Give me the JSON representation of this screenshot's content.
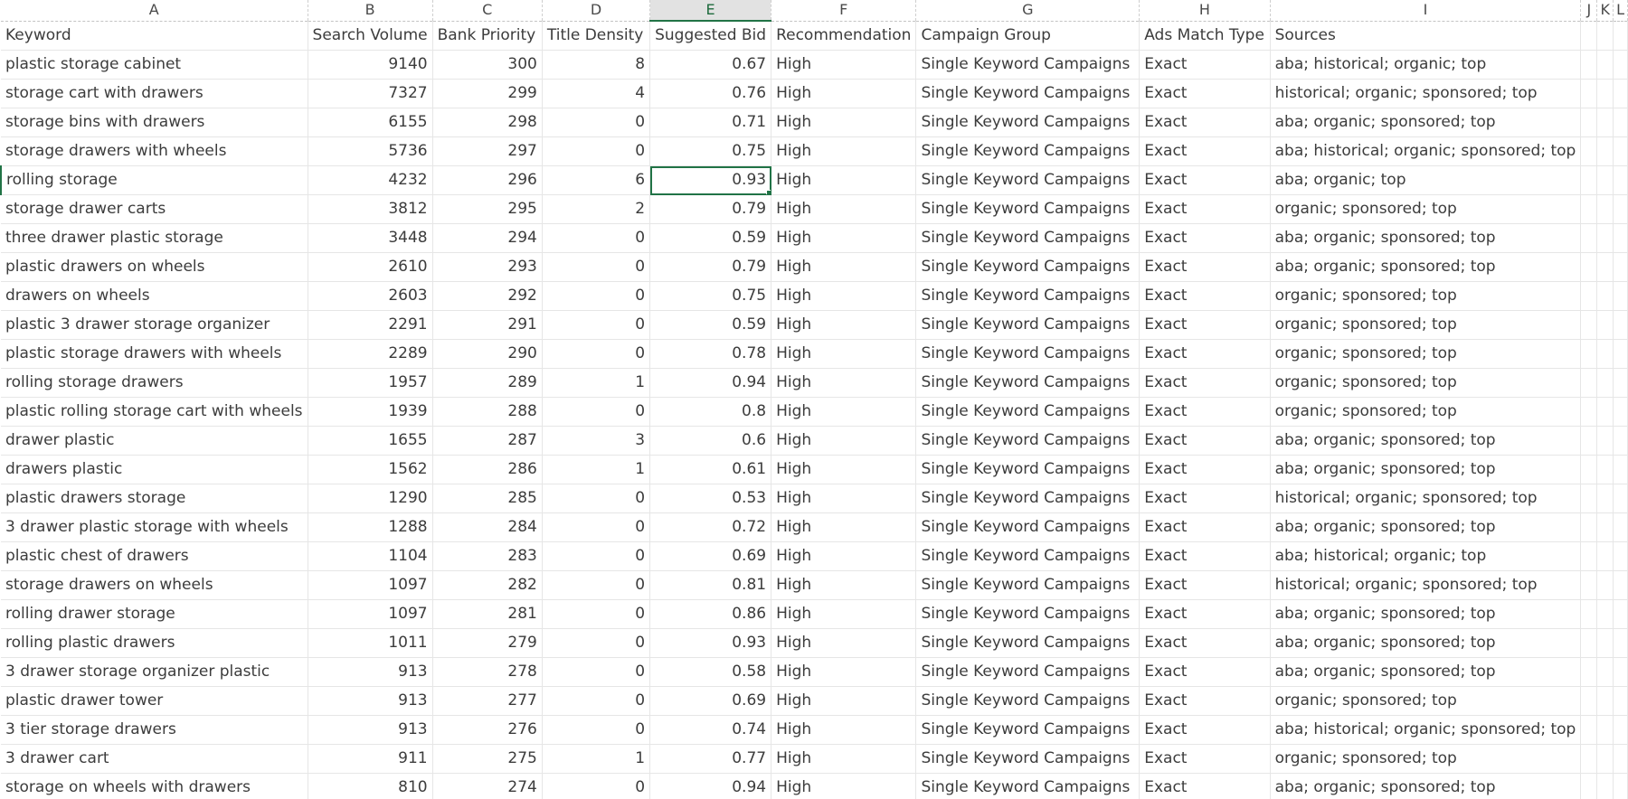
{
  "sheet": {
    "column_letters": [
      "A",
      "B",
      "C",
      "D",
      "E",
      "F",
      "G",
      "H",
      "I",
      "J",
      "K",
      "L"
    ],
    "active_column": "E",
    "headers": [
      "Keyword",
      "Search Volume",
      "Bank Priority",
      "Title Density",
      "Suggested Bid",
      "Recommendation",
      "Campaign Group",
      "Ads Match Type",
      "Sources"
    ],
    "selected_cell": "E5",
    "rows": [
      [
        "plastic storage cabinet",
        "9140",
        "300",
        "8",
        "0.67",
        "High",
        "Single Keyword Campaigns",
        "Exact",
        "aba; historical; organic; top"
      ],
      [
        "storage cart with drawers",
        "7327",
        "299",
        "4",
        "0.76",
        "High",
        "Single Keyword Campaigns",
        "Exact",
        "historical; organic; sponsored; top"
      ],
      [
        "storage bins with drawers",
        "6155",
        "298",
        "0",
        "0.71",
        "High",
        "Single Keyword Campaigns",
        "Exact",
        "aba; organic; sponsored; top"
      ],
      [
        "storage drawers with wheels",
        "5736",
        "297",
        "0",
        "0.75",
        "High",
        "Single Keyword Campaigns",
        "Exact",
        "aba; historical; organic; sponsored; top"
      ],
      [
        "rolling storage",
        "4232",
        "296",
        "6",
        "0.93",
        "High",
        "Single Keyword Campaigns",
        "Exact",
        "aba; organic; top"
      ],
      [
        "storage drawer carts",
        "3812",
        "295",
        "2",
        "0.79",
        "High",
        "Single Keyword Campaigns",
        "Exact",
        "organic; sponsored; top"
      ],
      [
        "three drawer plastic storage",
        "3448",
        "294",
        "0",
        "0.59",
        "High",
        "Single Keyword Campaigns",
        "Exact",
        "aba; organic; sponsored; top"
      ],
      [
        "plastic drawers on wheels",
        "2610",
        "293",
        "0",
        "0.79",
        "High",
        "Single Keyword Campaigns",
        "Exact",
        "aba; organic; sponsored; top"
      ],
      [
        "drawers on wheels",
        "2603",
        "292",
        "0",
        "0.75",
        "High",
        "Single Keyword Campaigns",
        "Exact",
        "organic; sponsored; top"
      ],
      [
        "plastic 3 drawer storage organizer",
        "2291",
        "291",
        "0",
        "0.59",
        "High",
        "Single Keyword Campaigns",
        "Exact",
        "organic; sponsored; top"
      ],
      [
        "plastic storage drawers with wheels",
        "2289",
        "290",
        "0",
        "0.78",
        "High",
        "Single Keyword Campaigns",
        "Exact",
        "organic; sponsored; top"
      ],
      [
        "rolling storage drawers",
        "1957",
        "289",
        "1",
        "0.94",
        "High",
        "Single Keyword Campaigns",
        "Exact",
        "organic; sponsored; top"
      ],
      [
        "plastic rolling storage cart with wheels",
        "1939",
        "288",
        "0",
        "0.8",
        "High",
        "Single Keyword Campaigns",
        "Exact",
        "organic; sponsored; top"
      ],
      [
        "drawer plastic",
        "1655",
        "287",
        "3",
        "0.6",
        "High",
        "Single Keyword Campaigns",
        "Exact",
        "aba; organic; sponsored; top"
      ],
      [
        "drawers plastic",
        "1562",
        "286",
        "1",
        "0.61",
        "High",
        "Single Keyword Campaigns",
        "Exact",
        "aba; organic; sponsored; top"
      ],
      [
        "plastic drawers storage",
        "1290",
        "285",
        "0",
        "0.53",
        "High",
        "Single Keyword Campaigns",
        "Exact",
        "historical; organic; sponsored; top"
      ],
      [
        "3 drawer plastic storage with wheels",
        "1288",
        "284",
        "0",
        "0.72",
        "High",
        "Single Keyword Campaigns",
        "Exact",
        "aba; organic; sponsored; top"
      ],
      [
        "plastic chest of drawers",
        "1104",
        "283",
        "0",
        "0.69",
        "High",
        "Single Keyword Campaigns",
        "Exact",
        "aba; historical; organic; top"
      ],
      [
        "storage drawers on wheels",
        "1097",
        "282",
        "0",
        "0.81",
        "High",
        "Single Keyword Campaigns",
        "Exact",
        "historical; organic; sponsored; top"
      ],
      [
        "rolling drawer storage",
        "1097",
        "281",
        "0",
        "0.86",
        "High",
        "Single Keyword Campaigns",
        "Exact",
        "aba; organic; sponsored; top"
      ],
      [
        "rolling plastic drawers",
        "1011",
        "279",
        "0",
        "0.93",
        "High",
        "Single Keyword Campaigns",
        "Exact",
        "aba; organic; sponsored; top"
      ],
      [
        "3 drawer storage organizer plastic",
        "913",
        "278",
        "0",
        "0.58",
        "High",
        "Single Keyword Campaigns",
        "Exact",
        "aba; organic; sponsored; top"
      ],
      [
        "plastic drawer tower",
        "913",
        "277",
        "0",
        "0.69",
        "High",
        "Single Keyword Campaigns",
        "Exact",
        "organic; sponsored; top"
      ],
      [
        "3 tier storage drawers",
        "913",
        "276",
        "0",
        "0.74",
        "High",
        "Single Keyword Campaigns",
        "Exact",
        "aba; historical; organic; sponsored; top"
      ],
      [
        "3 drawer cart",
        "911",
        "275",
        "1",
        "0.77",
        "High",
        "Single Keyword Campaigns",
        "Exact",
        "organic; sponsored; top"
      ],
      [
        "storage on wheels with drawers",
        "810",
        "274",
        "0",
        "0.94",
        "High",
        "Single Keyword Campaigns",
        "Exact",
        "aba; organic; sponsored; top"
      ]
    ]
  },
  "colors": {
    "accent": "#217346",
    "active_header_bg": "#e2e2e2",
    "gridline": "#e6e6e6",
    "text": "#3c3c3c"
  }
}
